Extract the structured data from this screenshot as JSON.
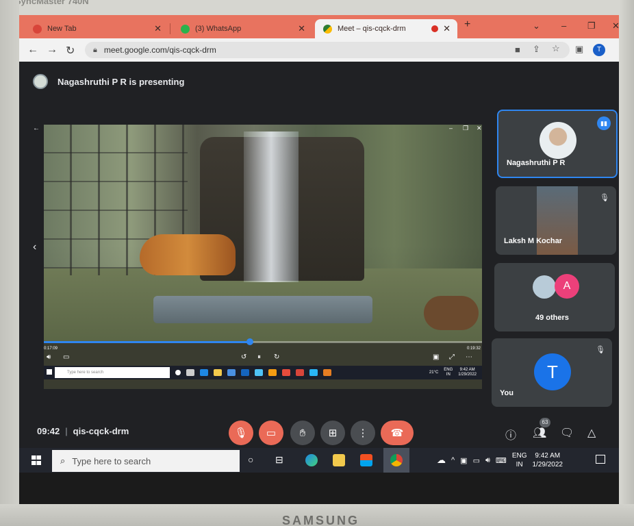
{
  "browser": {
    "tabs": [
      {
        "title": "New Tab",
        "fav_color": "#d8453a"
      },
      {
        "title": "(3) WhatsApp",
        "fav_color": "#2bb24c"
      },
      {
        "title": "Meet – qis-cqck-drm",
        "fav_color": "#2e7d32"
      }
    ],
    "url": "meet.google.com/qis-cqck-drm",
    "profile_initial": "T",
    "new_tab": "+",
    "minimize": "–",
    "restore": "❐",
    "close": "✕",
    "tab_close": "✕"
  },
  "meet": {
    "presenting_text": "Nagashruthi P R is presenting",
    "shared_video": {
      "time_elapsed": "0:17:09",
      "time_total": "0:19:32",
      "progress": 0.47,
      "mini_search_placeholder": "Type here to search",
      "mini_temp": "21°C",
      "mini_lang_top": "ENG",
      "mini_lang_bottom": "IN",
      "mini_time": "9:42 AM",
      "mini_date": "1/29/2022"
    },
    "participants": [
      {
        "name": "Nagashruthi P R",
        "speaking": true
      },
      {
        "name": "Laksh M Kochar",
        "muted": true
      },
      {
        "name": "49 others",
        "badge": "A"
      },
      {
        "name": "You",
        "initial": "T",
        "muted": true
      }
    ],
    "clock": "09:42",
    "meeting_code": "qis-cqck-drm",
    "participant_count": "63"
  },
  "taskbar": {
    "search_placeholder": "Type here to search",
    "lang_top": "ENG",
    "lang_bottom": "IN",
    "time": "9:42 AM",
    "date": "1/29/2022"
  },
  "monitor": {
    "top_label": "SyncMaster 740N",
    "brand": "SAMSUNG"
  },
  "colors": {
    "accent": "#2f86f0",
    "end_call": "#ea6a57",
    "tabstrip": "#e8735f"
  }
}
